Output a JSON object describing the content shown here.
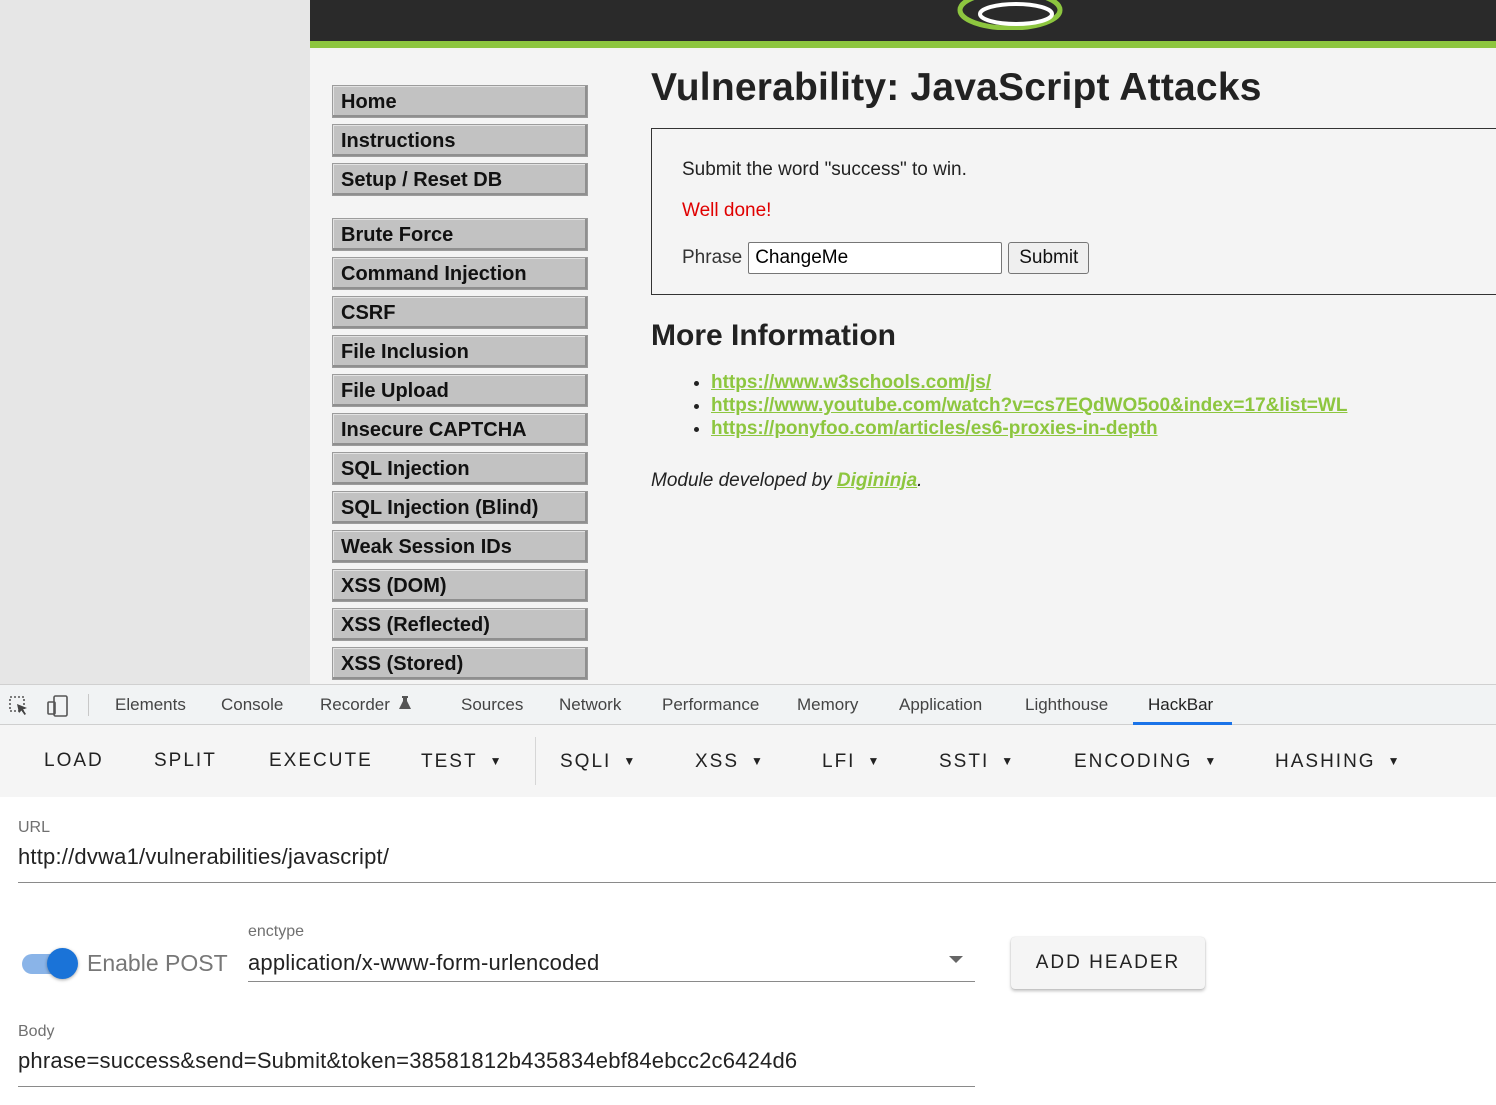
{
  "dvwa": {
    "menu_primary": [
      "Home",
      "Instructions",
      "Setup / Reset DB"
    ],
    "menu_vulns": [
      "Brute Force",
      "Command Injection",
      "CSRF",
      "File Inclusion",
      "File Upload",
      "Insecure CAPTCHA",
      "SQL Injection",
      "SQL Injection (Blind)",
      "Weak Session IDs",
      "XSS (DOM)",
      "XSS (Reflected)",
      "XSS (Stored)"
    ],
    "title": "Vulnerability: JavaScript Attacks",
    "instruction": "Submit the word \"success\" to win.",
    "result": "Well done!",
    "phrase_label": "Phrase",
    "phrase_value": "ChangeMe",
    "submit_label": "Submit",
    "more_info_title": "More Information",
    "links": [
      "https://www.w3schools.com/js/",
      "https://www.youtube.com/watch?v=cs7EQdWO5o0&index=17&list=WL",
      "https://ponyfoo.com/articles/es6-proxies-in-depth"
    ],
    "credit_prefix": "Module developed by ",
    "credit_author": "Digininja",
    "credit_suffix": ".",
    "accent_color": "#8dc63f",
    "result_color": "#e00000"
  },
  "devtools": {
    "tabs": [
      "Elements",
      "Console",
      "Recorder",
      "Sources",
      "Network",
      "Performance",
      "Memory",
      "Application",
      "Lighthouse",
      "HackBar"
    ],
    "active_tab": "HackBar",
    "icons": [
      "inspect-element-icon",
      "device-toolbar-icon",
      "flask-icon"
    ]
  },
  "hackbar": {
    "buttons": [
      "LOAD",
      "SPLIT",
      "EXECUTE",
      "TEST",
      "SQLI",
      "XSS",
      "LFI",
      "SSTI",
      "ENCODING",
      "HASHING"
    ],
    "url_label": "URL",
    "url_value": "http://dvwa1/vulnerabilities/javascript/",
    "enable_post_label": "Enable POST",
    "enable_post_on": true,
    "enctype_label": "enctype",
    "enctype_value": "application/x-www-form-urlencoded",
    "add_header_label": "ADD HEADER",
    "body_label": "Body",
    "body_value": "phrase=success&send=Submit&token=38581812b435834ebf84ebcc2c6424d6"
  }
}
